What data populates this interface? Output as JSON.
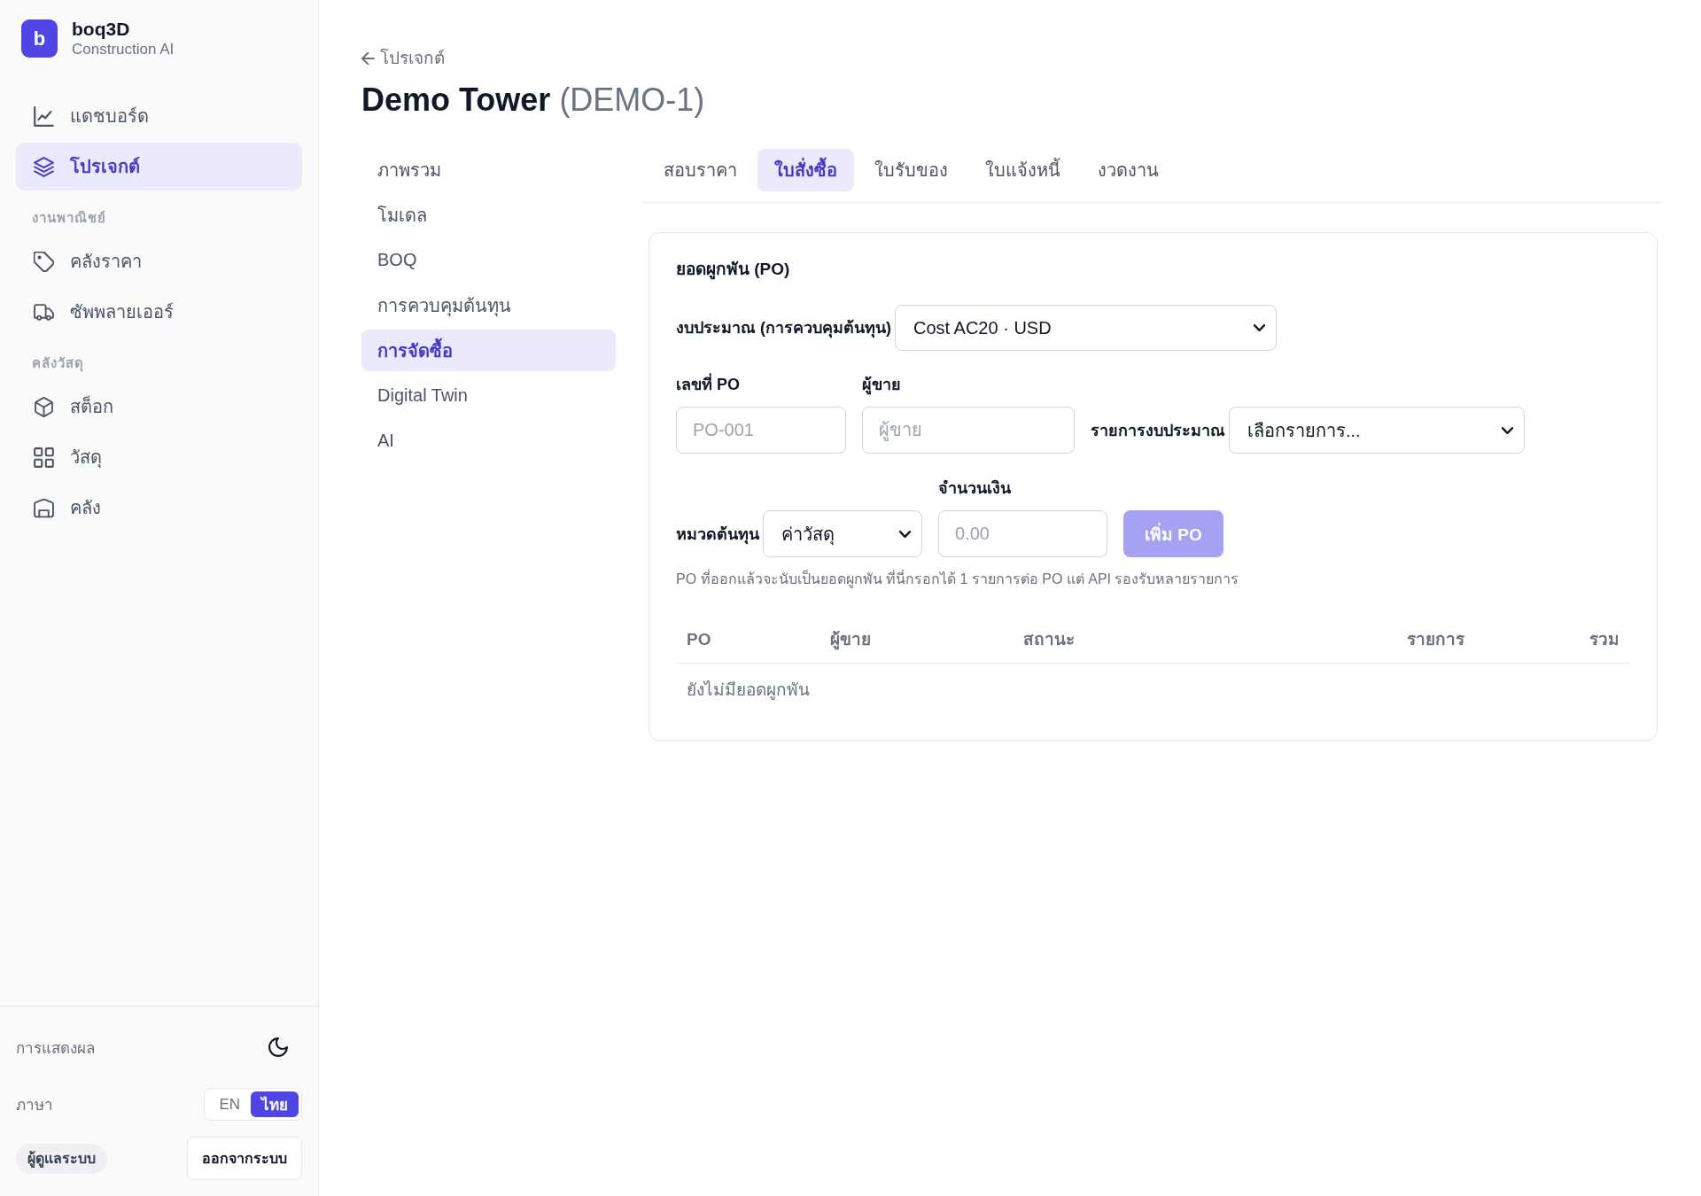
{
  "sidebar": {
    "brand": {
      "logo_letter": "b",
      "name": "boq3D",
      "tagline": "Construction AI"
    },
    "sections": [
      {
        "items": [
          {
            "label": "แดชบอร์ด",
            "selected": false
          },
          {
            "label": "โปรเจกต์",
            "selected": true
          }
        ]
      },
      {
        "heading": "งานพาณิชย์",
        "items": [
          {
            "label": "คลังราคา",
            "selected": false
          },
          {
            "label": "ซัพพลายเออร์",
            "selected": false
          }
        ]
      },
      {
        "heading": "คลังวัสดุ",
        "items": [
          {
            "label": "สต็อก",
            "selected": false
          },
          {
            "label": "วัสดุ",
            "selected": false
          },
          {
            "label": "คลัง",
            "selected": false
          }
        ]
      }
    ],
    "display": {
      "label": "การแสดงผล"
    },
    "language": {
      "label": "ภาษา",
      "options": [
        {
          "label": "EN",
          "selected": false
        },
        {
          "label": "ไทย",
          "selected": true
        }
      ]
    },
    "role_badge": "ผู้ดูแลระบบ",
    "logout_button": "ออกจากระบบ"
  },
  "header": {
    "back_link": "โปรเจกต์",
    "title": "Demo Tower",
    "code": "(DEMO-1)"
  },
  "section_nav": [
    {
      "label": "ภาพรวม",
      "selected": false
    },
    {
      "label": "โมเดล",
      "selected": false
    },
    {
      "label": "BOQ",
      "selected": false
    },
    {
      "label": "การควบคุมต้นทุน",
      "selected": false
    },
    {
      "label": "การจัดซื้อ",
      "selected": true
    },
    {
      "label": "Digital Twin",
      "selected": false
    },
    {
      "label": "AI",
      "selected": false
    }
  ],
  "tabs": [
    {
      "label": "สอบราคา",
      "selected": false
    },
    {
      "label": "ใบสั่งซื้อ",
      "selected": true
    },
    {
      "label": "ใบรับของ",
      "selected": false
    },
    {
      "label": "ใบแจ้งหนี้",
      "selected": false
    },
    {
      "label": "งวดงาน",
      "selected": false
    }
  ],
  "commitments_card": {
    "title": "ยอดผูกพัน (PO)",
    "budget": {
      "label": "งบประมาณ (การควบคุมต้นทุน)",
      "value": "Cost AC20 · USD"
    },
    "po_number": {
      "label": "เลขที่ PO",
      "placeholder": "PO-001"
    },
    "vendor": {
      "label": "ผู้ขาย",
      "placeholder": "ผู้ขาย"
    },
    "budget_item": {
      "label": "รายการงบประมาณ",
      "value": "เลือกรายการ..."
    },
    "cost_category": {
      "label": "หมวดต้นทุน",
      "value": "ค่าวัสดุ"
    },
    "amount": {
      "label": "จำนวนเงิน",
      "placeholder": "0.00"
    },
    "add_button": {
      "label": "เพิ่ม PO",
      "disabled": true
    },
    "hint": "PO ที่ออกแล้วจะนับเป็นยอดผูกพัน ที่นี่กรอกได้ 1 รายการต่อ PO แต่ API รองรับหลายรายการ",
    "table": {
      "columns": [
        "PO",
        "ผู้ขาย",
        "สถานะ",
        "รายการ",
        "รวม"
      ],
      "empty_text": "ยังไม่มียอดผูกพัน"
    }
  }
}
